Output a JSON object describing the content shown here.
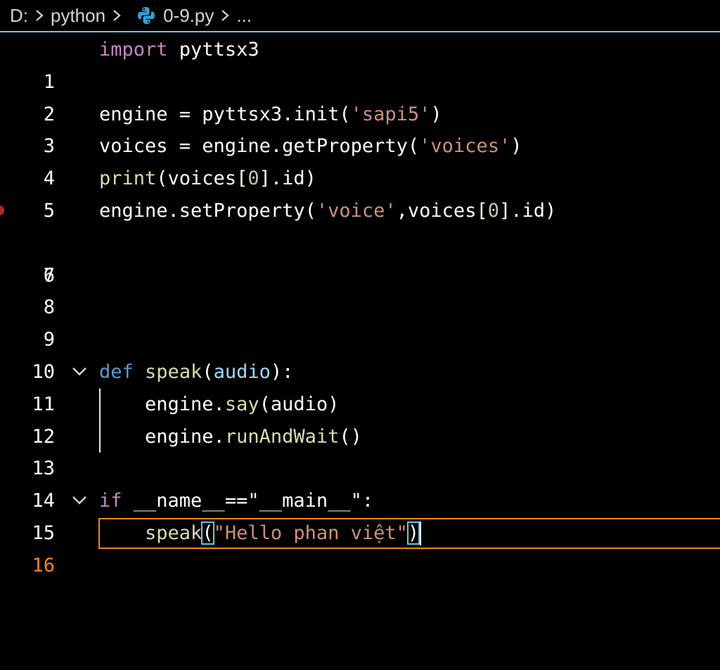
{
  "breadcrumb": {
    "drive": "D:",
    "folder": "python",
    "file": "0-9.py",
    "ellipsis": "..."
  },
  "colors": {
    "keyword_control": "#c586c0",
    "keyword_def": "#569cd6",
    "function": "#dcdcaa",
    "string": "#ce9178",
    "number": "#b5cea8",
    "variable": "#9cdcfe",
    "active_line": "#f38518",
    "accent": "#6fc3df",
    "breakpoint": "#b02828"
  },
  "editor": {
    "active_line_number": 16,
    "lines": [
      {
        "n": "1",
        "text": "import pyttsx3"
      },
      {
        "n": "2",
        "text": ""
      },
      {
        "n": "3",
        "text": "engine = pyttsx3.init('sapi5')"
      },
      {
        "n": "4",
        "text": "voices = engine.getProperty('voices')"
      },
      {
        "n": "5",
        "text": "print(voices[0].id)"
      },
      {
        "n": "6",
        "text": "engine.setProperty('voice',voices[0].id)"
      },
      {
        "n": "7",
        "text": ""
      },
      {
        "n": "8",
        "text": ""
      },
      {
        "n": "9",
        "text": ""
      },
      {
        "n": "10",
        "text": ""
      },
      {
        "n": "11",
        "text": "def speak(audio):"
      },
      {
        "n": "12",
        "text": "    engine.say(audio)"
      },
      {
        "n": "13",
        "text": "    engine.runAndWait()"
      },
      {
        "n": "14",
        "text": ""
      },
      {
        "n": "15",
        "text": "if __name__==\"__main__\":"
      },
      {
        "n": "16",
        "text": "    speak(\"Hello phan việt\")"
      }
    ],
    "tokens": {
      "l1_import": "import",
      "l1_module": " pyttsx3",
      "l3_a": "engine = pyttsx3.init(",
      "l3_str": "'sapi5'",
      "l3_b": ")",
      "l4_a": "voices = engine.getProperty(",
      "l4_str": "'voices'",
      "l4_b": ")",
      "l5_print": "print",
      "l5_a": "(voices[",
      "l5_num": "0",
      "l5_b": "].id)",
      "l6_a": "engine.setProperty(",
      "l6_str": "'voice'",
      "l6_b": ",voices[",
      "l6_num": "0",
      "l6_c": "].id)",
      "l11_def": "def",
      "l11_sp": " ",
      "l11_name": "speak",
      "l11_a": "(",
      "l11_param": "audio",
      "l11_b": "):",
      "l12_a": "    engine.",
      "l12_fn": "say",
      "l12_b": "(audio)",
      "l13_a": "    engine.",
      "l13_fn": "runAndWait",
      "l13_b": "()",
      "l15_if": "if",
      "l15_rest": " __name__==\"__main__\":",
      "l16_indent": "    ",
      "l16_fn": "speak",
      "l16_open": "(",
      "l16_str": "\"Hello phan việt\"",
      "l16_close": ")"
    }
  }
}
